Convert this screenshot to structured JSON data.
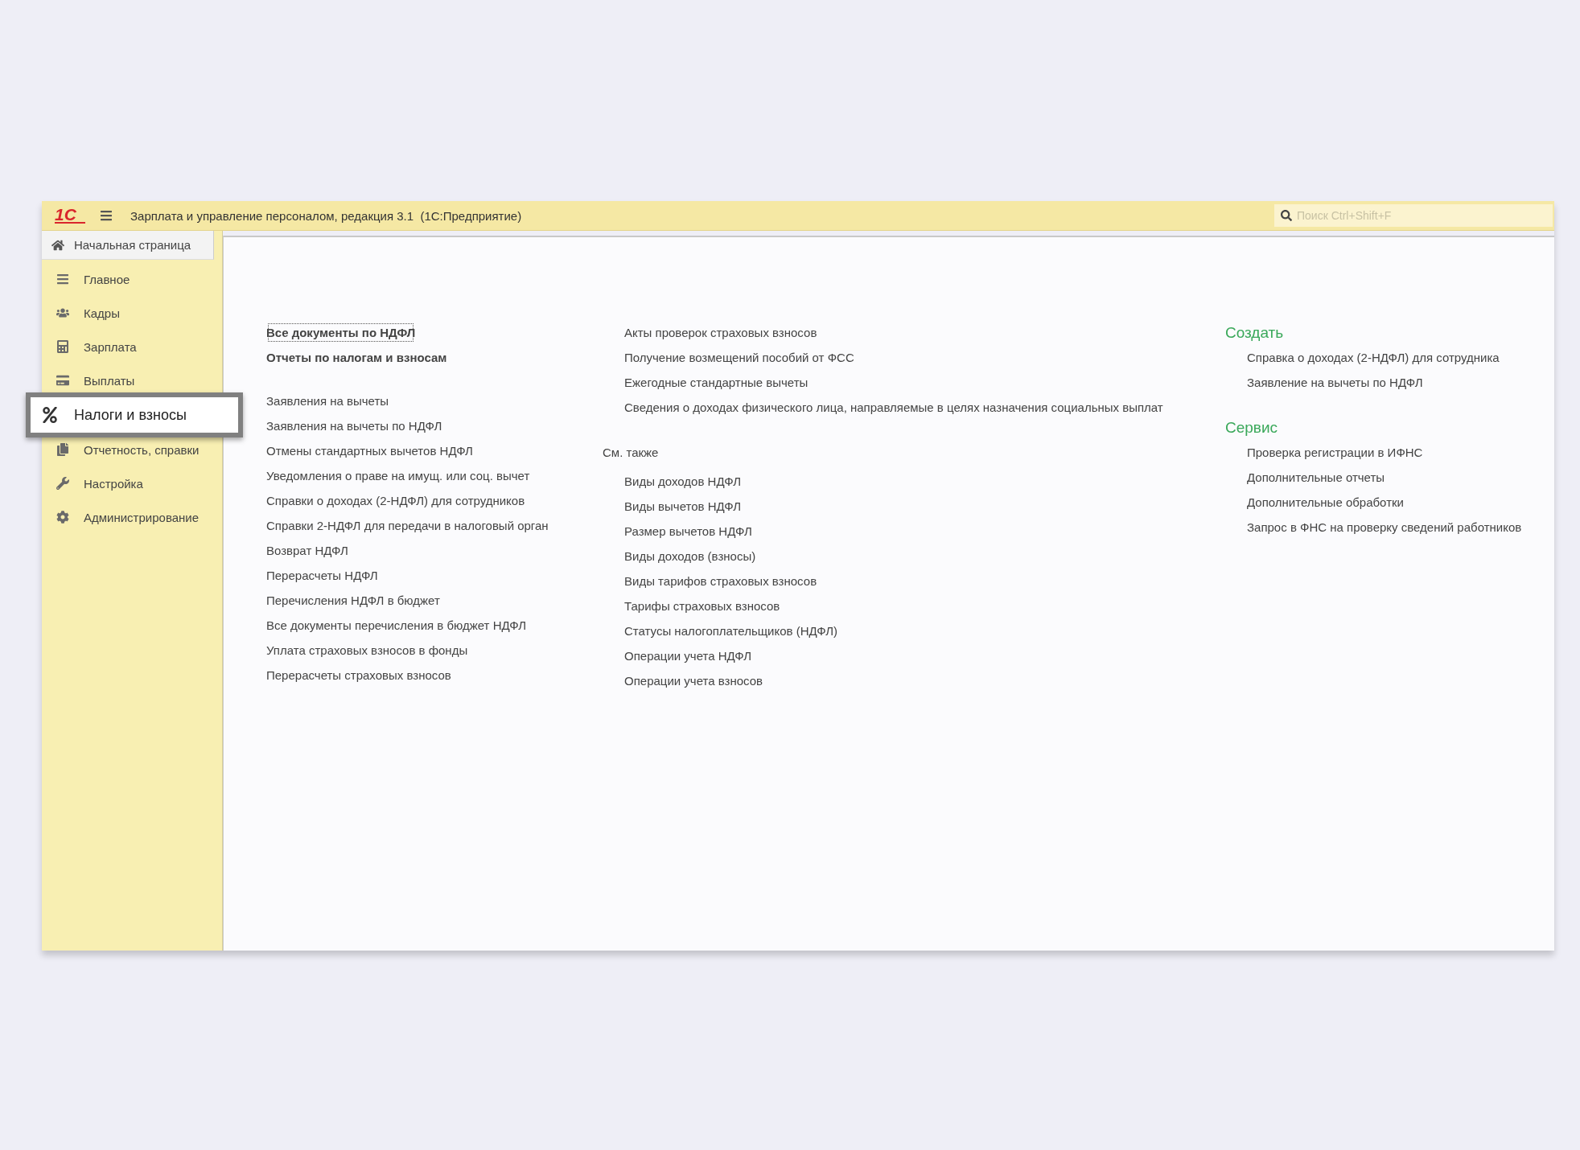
{
  "window": {
    "logo": "1С",
    "title": "Зарплата и управление персоналом, редакция 3.1  (1С:Предприятие)",
    "search": {
      "placeholder": "Поиск Ctrl+Shift+F"
    }
  },
  "home_tab": {
    "label": "Начальная страница"
  },
  "sidebar": {
    "items": [
      {
        "label": "Главное",
        "kind": "lines",
        "selected": false
      },
      {
        "label": "Кадры",
        "kind": "people",
        "selected": false
      },
      {
        "label": "Зарплата",
        "kind": "calculator",
        "selected": false
      },
      {
        "label": "Выплаты",
        "kind": "card",
        "selected": false
      },
      {
        "label": "Налоги и взносы",
        "kind": "percent",
        "selected": true
      },
      {
        "label": "Отчетность, справки",
        "kind": "documents",
        "selected": false
      },
      {
        "label": "Настройка",
        "kind": "wrench",
        "selected": false
      },
      {
        "label": "Администрирование",
        "kind": "gear",
        "selected": false
      }
    ]
  },
  "content": {
    "column_1": {
      "groups": [
        {
          "kind": "important",
          "items": [
            {
              "label": "Все документы по НДФЛ",
              "focused": true
            },
            {
              "label": "Отчеты по налогам и взносам",
              "focused": false
            }
          ]
        },
        {
          "kind": "normal",
          "items": [
            {
              "label": "Заявления на вычеты"
            },
            {
              "label": "Заявления на вычеты по НДФЛ"
            },
            {
              "label": "Отмены стандартных вычетов НДФЛ"
            },
            {
              "label": "Уведомления о праве на имущ. или соц. вычет"
            },
            {
              "label": "Справки о доходах (2-НДФЛ) для сотрудников"
            },
            {
              "label": "Справки 2-НДФЛ для передачи в налоговый орган"
            },
            {
              "label": "Возврат НДФЛ"
            },
            {
              "label": "Перерасчеты НДФЛ"
            },
            {
              "label": "Перечисления НДФЛ в бюджет"
            },
            {
              "label": "Все документы перечисления в бюджет НДФЛ"
            },
            {
              "label": "Уплата страховых взносов в фонды"
            },
            {
              "label": "Перерасчеты страховых взносов"
            }
          ]
        }
      ]
    },
    "column_2": {
      "items": [
        "Акты проверок страховых взносов",
        "Получение возмещений пособий от ФСС",
        "Ежегодные стандартные вычеты",
        "Сведения о доходах физического лица, направляемые в целях назначения социальных выплат"
      ],
      "see_also": {
        "title": "См. также",
        "items": [
          "Виды доходов НДФЛ",
          "Виды вычетов НДФЛ",
          "Размер вычетов НДФЛ",
          "Виды доходов (взносы)",
          "Виды тарифов страховых взносов",
          "Тарифы страховых взносов",
          "Статусы налогоплательщиков (НДФЛ)",
          "Операции учета НДФЛ",
          "Операции учета взносов"
        ]
      }
    },
    "column_3": {
      "sections": [
        {
          "title": "Создать",
          "items": [
            "Справка о доходах (2-НДФЛ) для сотрудника",
            "Заявление на вычеты по НДФЛ"
          ]
        },
        {
          "title": "Сервис",
          "items": [
            "Проверка регистрации в ИФНС",
            "Дополнительные отчеты",
            "Дополнительные обработки",
            "Запрос в ФНС на проверку сведений работников"
          ]
        }
      ]
    }
  }
}
